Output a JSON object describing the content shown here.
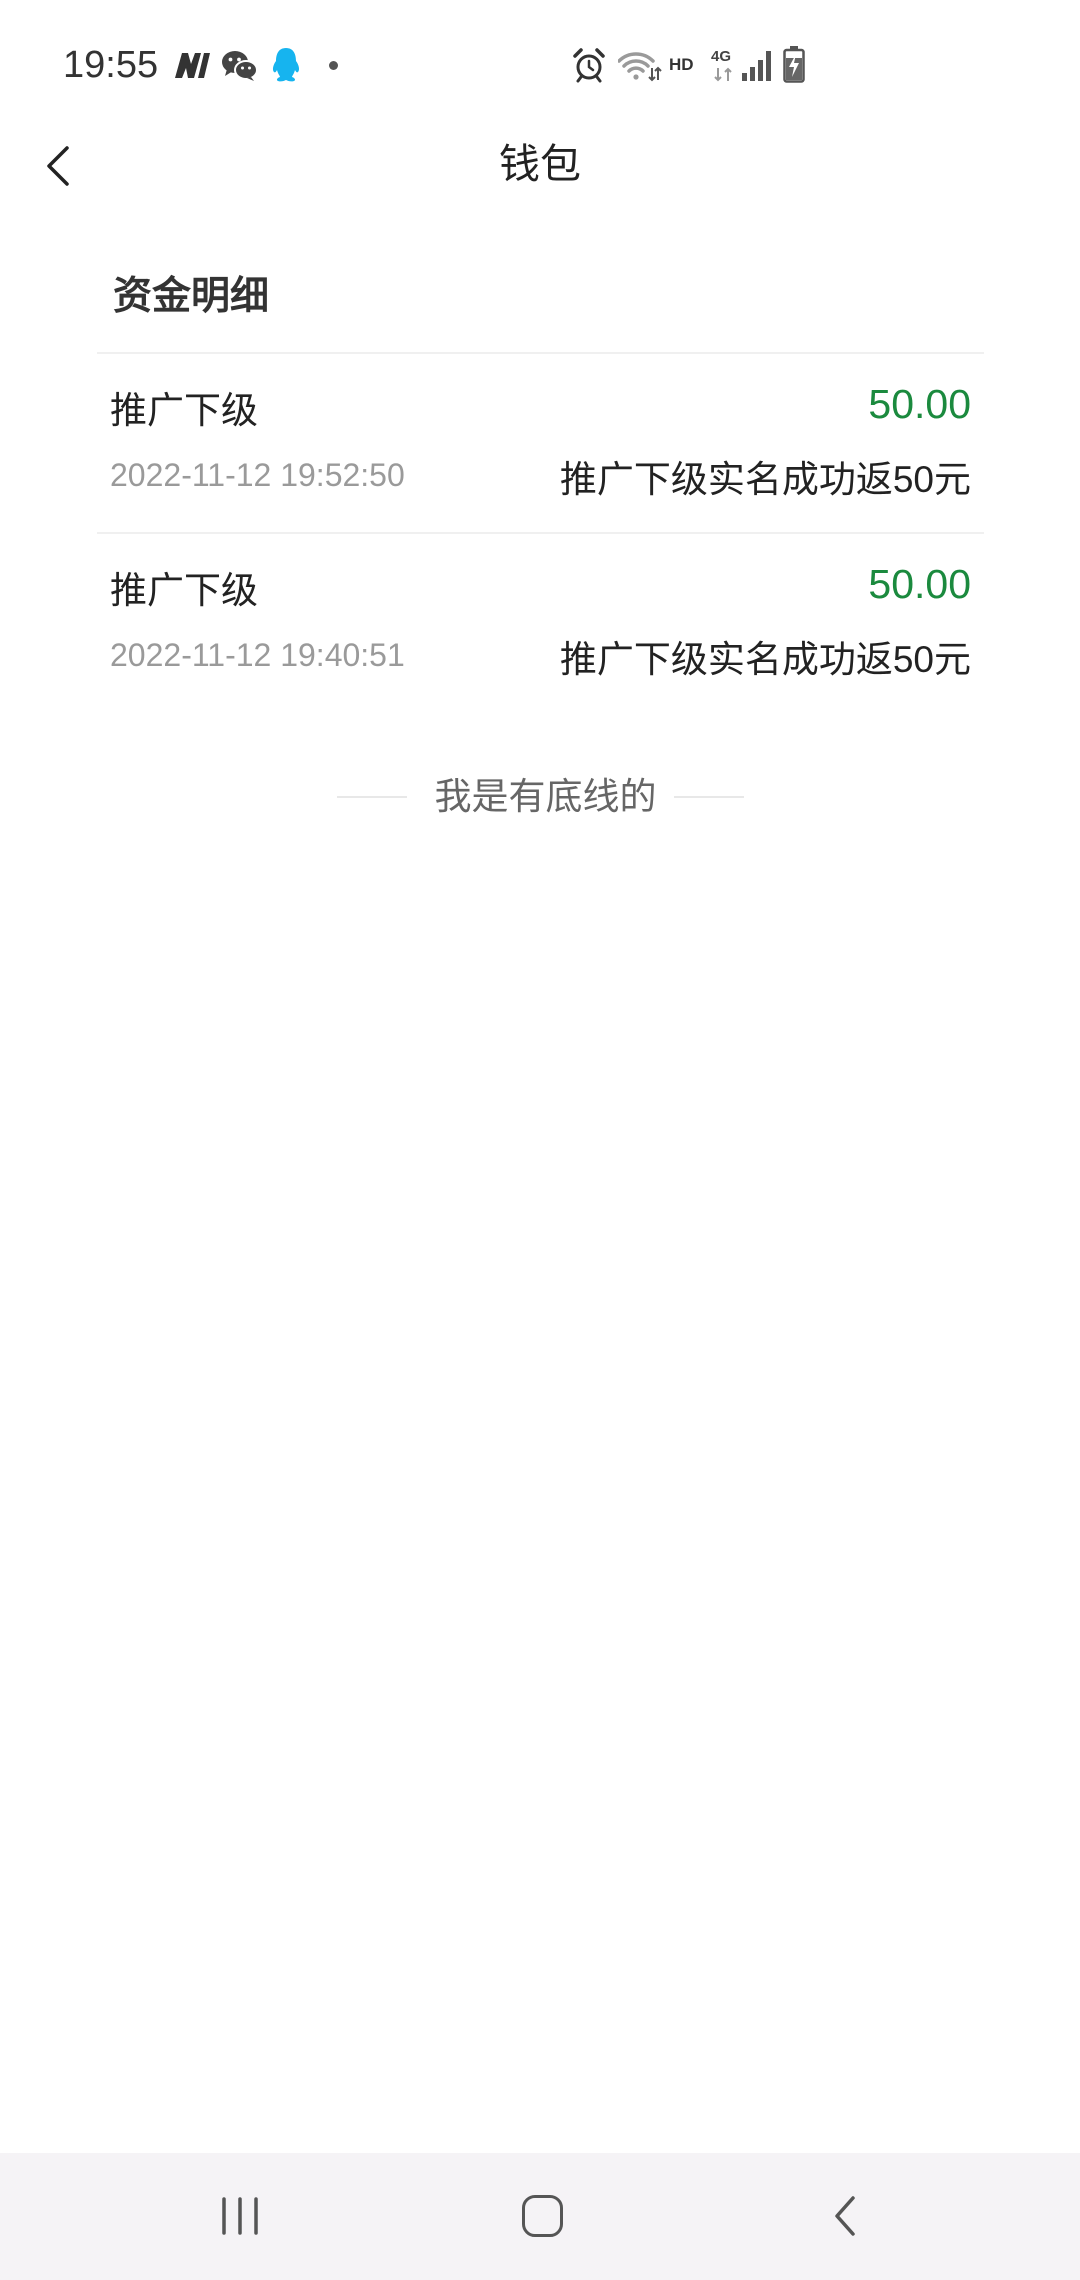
{
  "status_bar": {
    "time": "19:55",
    "hd_label": "HD",
    "network_label": "4G",
    "left_icons": [
      "app-notification-icon",
      "wechat-icon",
      "qq-icon",
      "notification-dot"
    ],
    "right_icons": [
      "alarm-icon",
      "wifi-icon",
      "hd-label",
      "4g-label",
      "signal-icon",
      "battery-charging-icon"
    ]
  },
  "header": {
    "title": "钱包",
    "back_icon": "chevron-left-icon"
  },
  "funds": {
    "section_title": "资金明细",
    "transactions": [
      {
        "title": "推广下级",
        "amount": "50.00",
        "datetime": "2022-11-12 19:52:50",
        "description": "推广下级实名成功返50元"
      },
      {
        "title": "推广下级",
        "amount": "50.00",
        "datetime": "2022-11-12 19:40:51",
        "description": "推广下级实名成功返50元"
      }
    ],
    "end_of_list_text": "我是有底线的"
  },
  "nav_bar": {
    "buttons": [
      "recent-apps-icon",
      "home-icon",
      "back-icon"
    ]
  },
  "colors": {
    "amount": "#1b8a3e",
    "qq_icon": "#16b4ef",
    "nav_bar_background": "#f5f3f6",
    "secondary_text": "#9a9a9a",
    "divider": "#f0f0f0"
  }
}
